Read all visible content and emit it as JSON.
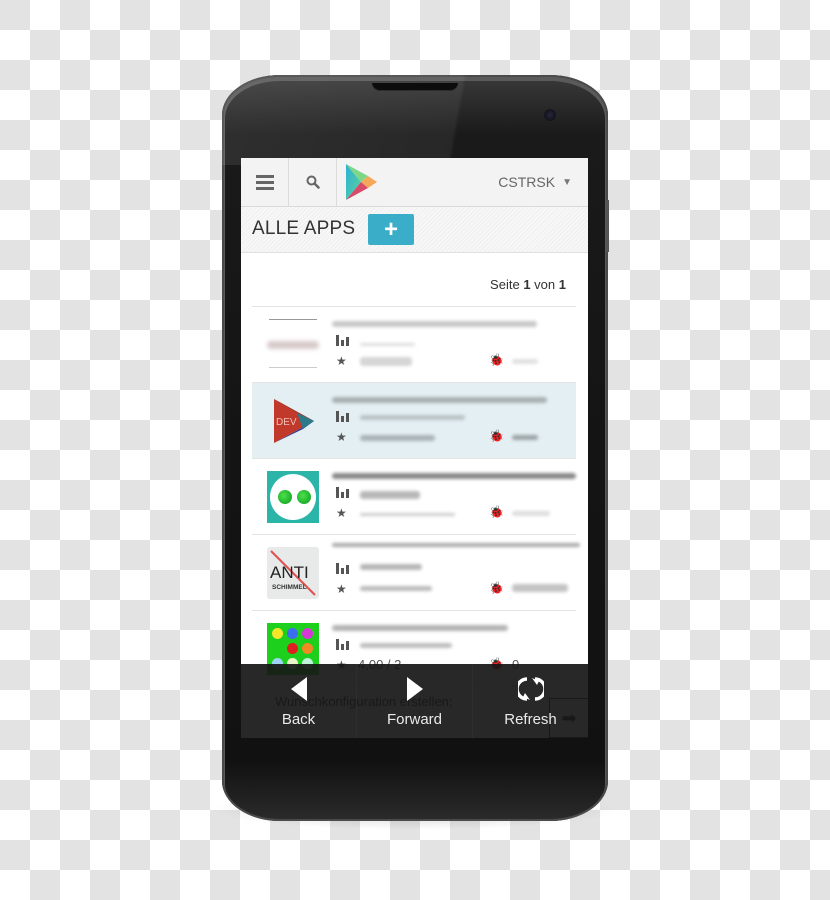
{
  "device": {
    "name": "android-phone-mockup"
  },
  "header": {
    "menu_icon": "hamburger-icon",
    "search_icon": "search-icon",
    "logo": "play-store-logo",
    "account_name": "CSTRSK",
    "account_caret": "▼"
  },
  "title_row": {
    "title": "ALLE APPS",
    "add_button_label": "+"
  },
  "pager": {
    "prefix": "Seite",
    "current": "1",
    "middle": "von",
    "total": "1"
  },
  "apps": [
    {
      "icon": "blank-app-icon",
      "selected": false,
      "name": "",
      "rating_visible": "",
      "bugs_visible": ""
    },
    {
      "icon": "play-dev-icon",
      "icon_label": "DEV",
      "selected": true,
      "name": "",
      "rating_visible": "",
      "bugs_visible": ""
    },
    {
      "icon": "robot-face-icon",
      "selected": false,
      "name": "",
      "rating_visible": "",
      "bugs_visible": ""
    },
    {
      "icon": "anti-schimmel-icon",
      "icon_label_top": "ANTI",
      "icon_label_bottom": "SCHIMMEL",
      "selected": false,
      "name": "",
      "rating_visible": "",
      "bugs_visible": ""
    },
    {
      "icon": "color-dots-icon",
      "selected": false,
      "name": "",
      "rating_visible": "4,00 / 2",
      "bugs_visible": "0"
    }
  ],
  "behind_nav": {
    "text": "Wunschkonfiguration erstellen:",
    "arrow": "➡"
  },
  "navbar": {
    "back_label": "Back",
    "forward_label": "Forward",
    "refresh_label": "Refresh"
  },
  "colors": {
    "accent": "#3aaec9",
    "selected_row": "#e3eff3",
    "navbar_bg": "#161616"
  }
}
